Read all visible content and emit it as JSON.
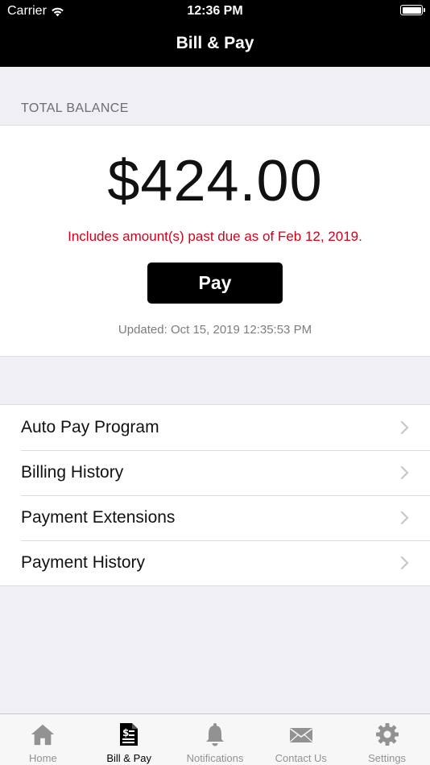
{
  "status_bar": {
    "carrier": "Carrier",
    "time": "12:36 PM"
  },
  "nav": {
    "title": "Bill & Pay"
  },
  "balance": {
    "section_label": "TOTAL BALANCE",
    "amount": "$424.00",
    "past_due_notice": "Includes amount(s) past due as of Feb 12, 2019.",
    "pay_label": "Pay",
    "updated": "Updated: Oct 15, 2019 12:35:53 PM"
  },
  "menu": {
    "items": [
      {
        "label": "Auto Pay Program"
      },
      {
        "label": "Billing History"
      },
      {
        "label": "Payment Extensions"
      },
      {
        "label": "Payment History"
      }
    ]
  },
  "tab_bar": {
    "active_tab": "Bill & Pay",
    "tabs": [
      {
        "label": "Home",
        "icon": "home-icon"
      },
      {
        "label": "Bill & Pay",
        "icon": "bill-icon"
      },
      {
        "label": "Notifications",
        "icon": "bell-icon"
      },
      {
        "label": "Contact Us",
        "icon": "envelope-icon"
      },
      {
        "label": "Settings",
        "icon": "gear-icon"
      }
    ]
  },
  "colors": {
    "header_bg": "#000000",
    "past_due_text": "#d0021b",
    "pay_button_bg": "#000000",
    "page_bg": "#efeff4",
    "tab_inactive": "#929292",
    "tab_active": "#000000"
  }
}
